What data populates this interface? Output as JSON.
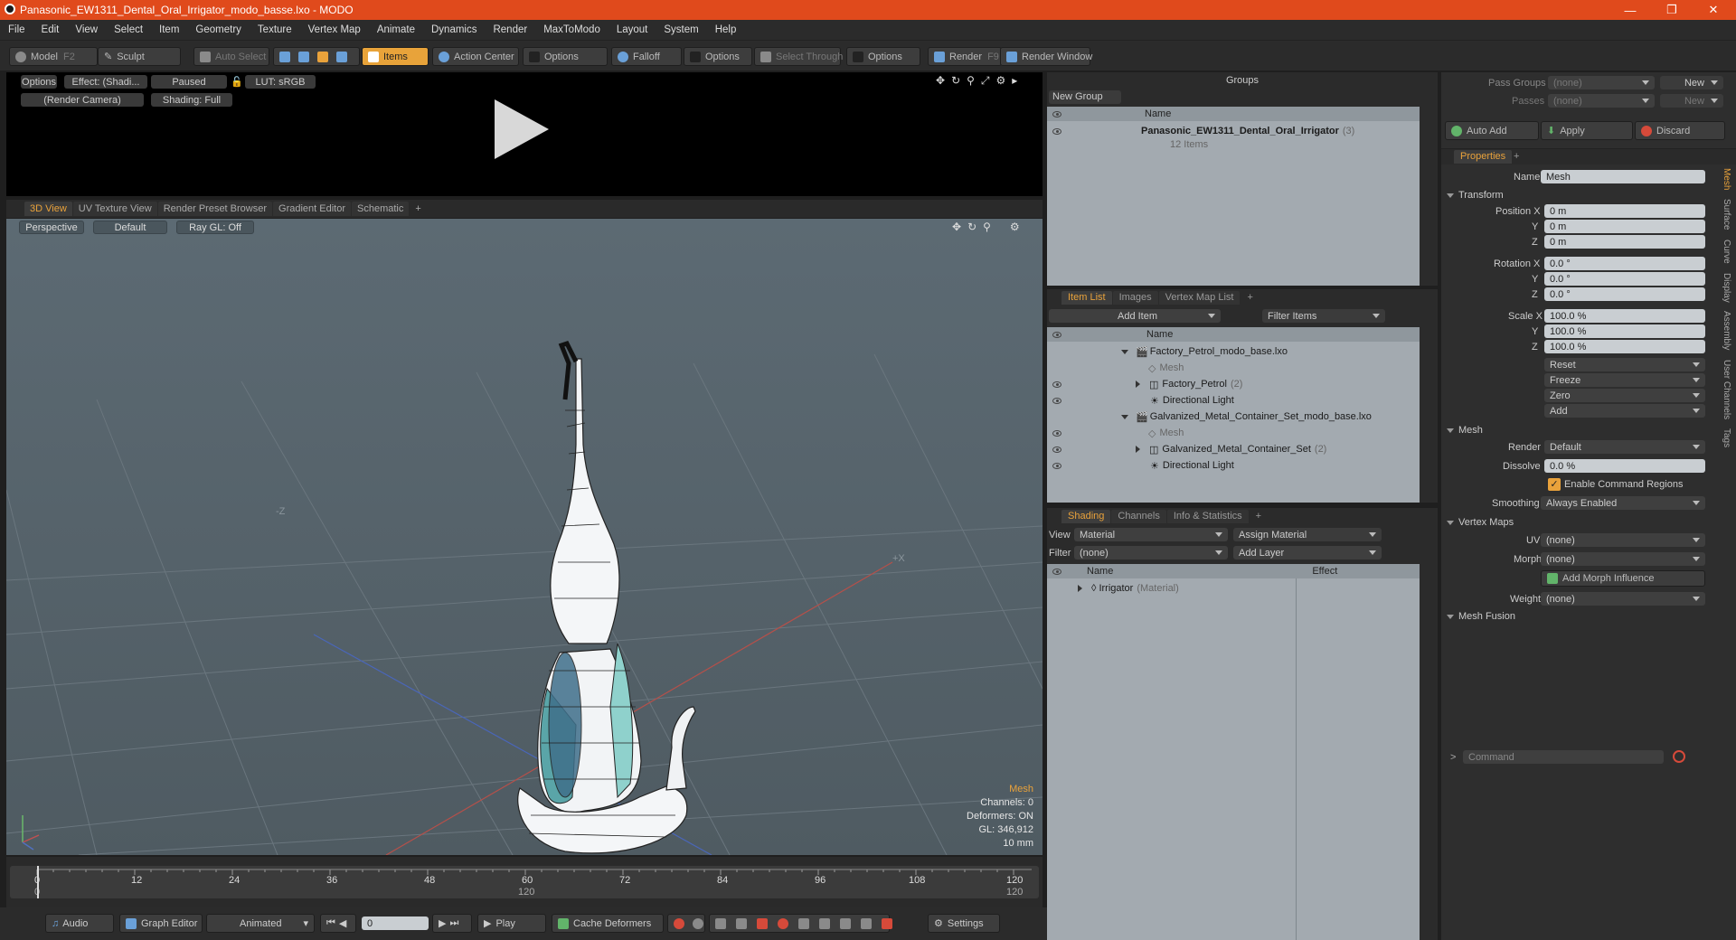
{
  "window": {
    "title": "Panasonic_EW1311_Dental_Oral_Irrigator_modo_basse.lxo - MODO"
  },
  "menu": [
    "File",
    "Edit",
    "View",
    "Select",
    "Item",
    "Geometry",
    "Texture",
    "Vertex Map",
    "Animate",
    "Dynamics",
    "Render",
    "MaxToModo",
    "Layout",
    "System",
    "Help"
  ],
  "toolbar": {
    "model": "Model",
    "model_key": "F2",
    "sculpt": "Sculpt",
    "auto_select": "Auto Select",
    "items": "Items",
    "action_center": "Action Center",
    "options1": "Options",
    "falloff": "Falloff",
    "options2": "Options",
    "select_through": "Select Through",
    "options3": "Options",
    "render": "Render",
    "render_key": "F9",
    "render_window": "Render Window"
  },
  "render_preview": {
    "options": "Options",
    "effect": "Effect: (Shadi...",
    "paused": "Paused",
    "lut": "LUT: sRGB",
    "camera": "(Render Camera)",
    "shading": "Shading: Full"
  },
  "view_tabs": [
    "3D View",
    "UV Texture View",
    "Render Preset Browser",
    "Gradient Editor",
    "Schematic",
    "+"
  ],
  "viewport": {
    "projection": "Perspective",
    "style": "Default",
    "raygl": "Ray GL: Off",
    "axis_minus_z": "-Z",
    "axis_plus_x": "+X",
    "info": {
      "type": "Mesh",
      "channels": "Channels: 0",
      "deformers": "Deformers: ON",
      "gl": "GL: 346,912",
      "units": "10 mm"
    }
  },
  "timeline": {
    "ticks": [
      "0",
      "12",
      "24",
      "36",
      "48",
      "60",
      "72",
      "84",
      "96",
      "108",
      "120"
    ],
    "sub_ticks": [
      "0",
      "120",
      "120"
    ]
  },
  "bottombar": {
    "audio": "Audio",
    "graph_editor": "Graph Editor",
    "animated": "Animated",
    "frame": "0",
    "play": "Play",
    "cache_deformers": "Cache Deformers",
    "settings": "Settings"
  },
  "groups": {
    "title": "Groups",
    "new_group": "New Group",
    "col_name": "Name",
    "item_name": "Panasonic_EW1311_Dental_Oral_Irrigator",
    "item_count": "(3)",
    "item_sub": "12 Items"
  },
  "item_list": {
    "tabs": [
      "Item List",
      "Images",
      "Vertex Map List",
      "+"
    ],
    "add_item": "Add Item",
    "filter": "Filter Items",
    "col_name": "Name",
    "rows": [
      {
        "name": "Factory_Petrol_modo_base.lxo",
        "suffix": ""
      },
      {
        "name": "Mesh",
        "suffix": ""
      },
      {
        "name": "Factory_Petrol",
        "suffix": "(2)"
      },
      {
        "name": "Directional Light",
        "suffix": ""
      },
      {
        "name": "Galvanized_Metal_Container_Set_modo_base.lxo",
        "suffix": ""
      },
      {
        "name": "Mesh",
        "suffix": ""
      },
      {
        "name": "Galvanized_Metal_Container_Set",
        "suffix": "(2)"
      },
      {
        "name": "Directional Light",
        "suffix": ""
      }
    ]
  },
  "shading": {
    "tabs": [
      "Shading",
      "Channels",
      "Info & Statistics",
      "+"
    ],
    "view_label": "View",
    "view_value": "Material",
    "assign": "Assign Material",
    "filter_label": "Filter",
    "filter_value": "(none)",
    "add_layer": "Add Layer",
    "col_name": "Name",
    "col_effect": "Effect",
    "row_name": "Irrigator",
    "row_type": "(Material)"
  },
  "passes": {
    "pass_groups": "Pass Groups",
    "passes": "Passes",
    "none1": "(none)",
    "none2": "(none)",
    "new1": "New",
    "new2": "New"
  },
  "actions": {
    "auto_add": "Auto Add",
    "apply": "Apply",
    "discard": "Discard"
  },
  "properties": {
    "tab": "Properties",
    "name_label": "Name",
    "name_value": "Mesh",
    "transform": "Transform",
    "pos": [
      "0 m",
      "0 m",
      "0 m"
    ],
    "rot": [
      "0.0 °",
      "0.0 °",
      "0.0 °"
    ],
    "scale": [
      "100.0 %",
      "100.0 %",
      "100.0 %"
    ],
    "labels": {
      "position_x": "Position X",
      "rotation_x": "Rotation X",
      "scale_x": "Scale X",
      "y": "Y",
      "z": "Z"
    },
    "buttons": [
      "Reset",
      "Freeze",
      "Zero",
      "Add"
    ],
    "mesh": "Mesh",
    "render_label": "Render",
    "render_value": "Default",
    "dissolve_label": "Dissolve",
    "dissolve_value": "0.0 %",
    "enable_cmd": "Enable Command Regions",
    "smoothing_label": "Smoothing",
    "smoothing_value": "Always Enabled",
    "vertex_maps": "Vertex Maps",
    "uv_label": "UV",
    "uv_value": "(none)",
    "morph_label": "Morph",
    "morph_value": "(none)",
    "add_morph": "Add Morph Influence",
    "weight_label": "Weight",
    "weight_value": "(none)",
    "mesh_fusion": "Mesh Fusion",
    "side_tabs": [
      "Mesh",
      "Surface",
      "Curve",
      "Display",
      "Assembly",
      "User Channels",
      "Tags"
    ],
    "command": "Command"
  }
}
